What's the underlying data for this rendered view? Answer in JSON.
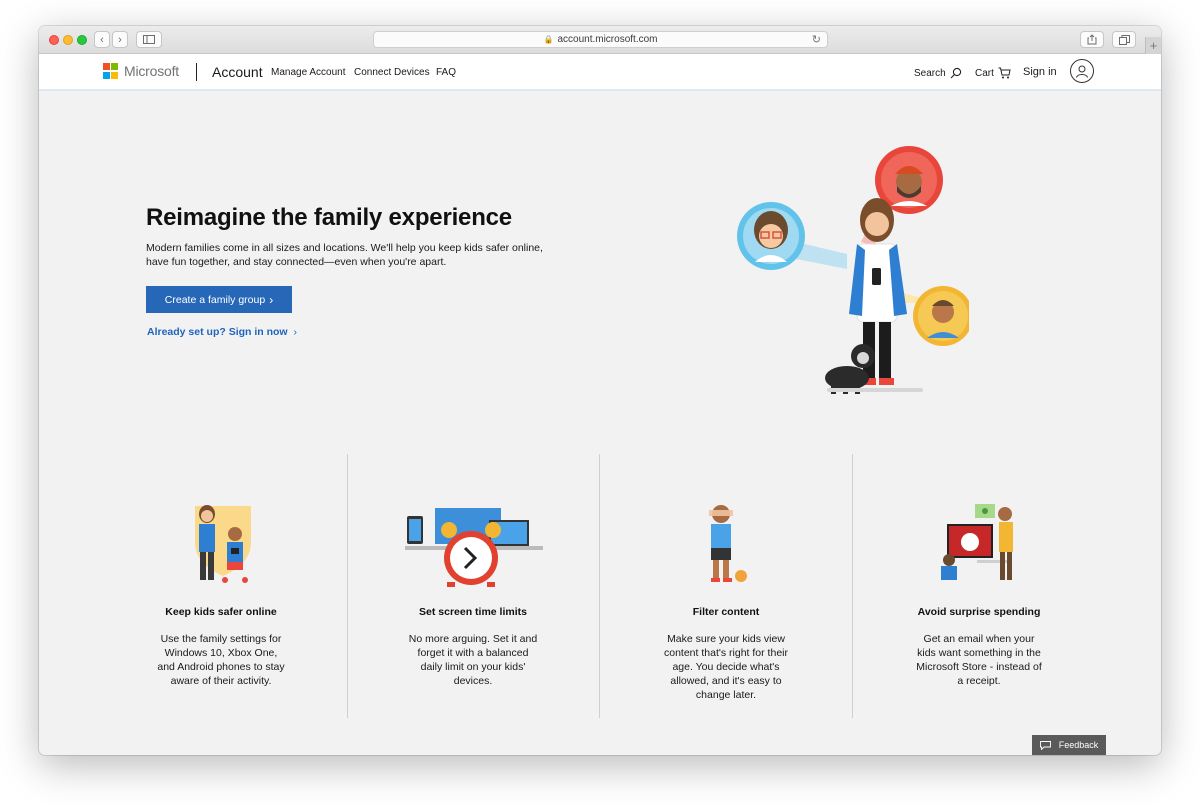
{
  "browser": {
    "url": "account.microsoft.com"
  },
  "header": {
    "brand": "Microsoft",
    "section": "Account",
    "nav": [
      "Manage Account",
      "Connect Devices",
      "FAQ"
    ],
    "search_label": "Search",
    "cart_label": "Cart",
    "signin_label": "Sign in"
  },
  "hero": {
    "title": "Reimagine the family experience",
    "description": "Modern families come in all sizes and locations. We'll help you keep kids safer online, have fun together, and stay connected—even when you're apart.",
    "primary_button": "Create a family group",
    "secondary_link": "Already set up? Sign in now"
  },
  "features": [
    {
      "title": "Keep kids safer online",
      "text": "Use the family settings for Windows 10, Xbox One, and Android phones to stay aware of their activity."
    },
    {
      "title": "Set screen time limits",
      "text": "No more arguing. Set it and forget it with a balanced daily limit on your kids' devices."
    },
    {
      "title": "Filter content",
      "text": "Make sure your kids view content that's right for their age. You decide what's allowed, and it's easy to change later."
    },
    {
      "title": "Avoid surprise spending",
      "text": "Get an email when your kids want something in the Microsoft Store - instead of a receipt."
    }
  ],
  "feedback_label": "Feedback",
  "colors": {
    "brand_blue": "#2767b8",
    "link_blue": "#1e64bd",
    "logo_red": "#f25022",
    "logo_green": "#7fba00",
    "logo_blue": "#00a4ef",
    "logo_yellow": "#ffb900"
  }
}
